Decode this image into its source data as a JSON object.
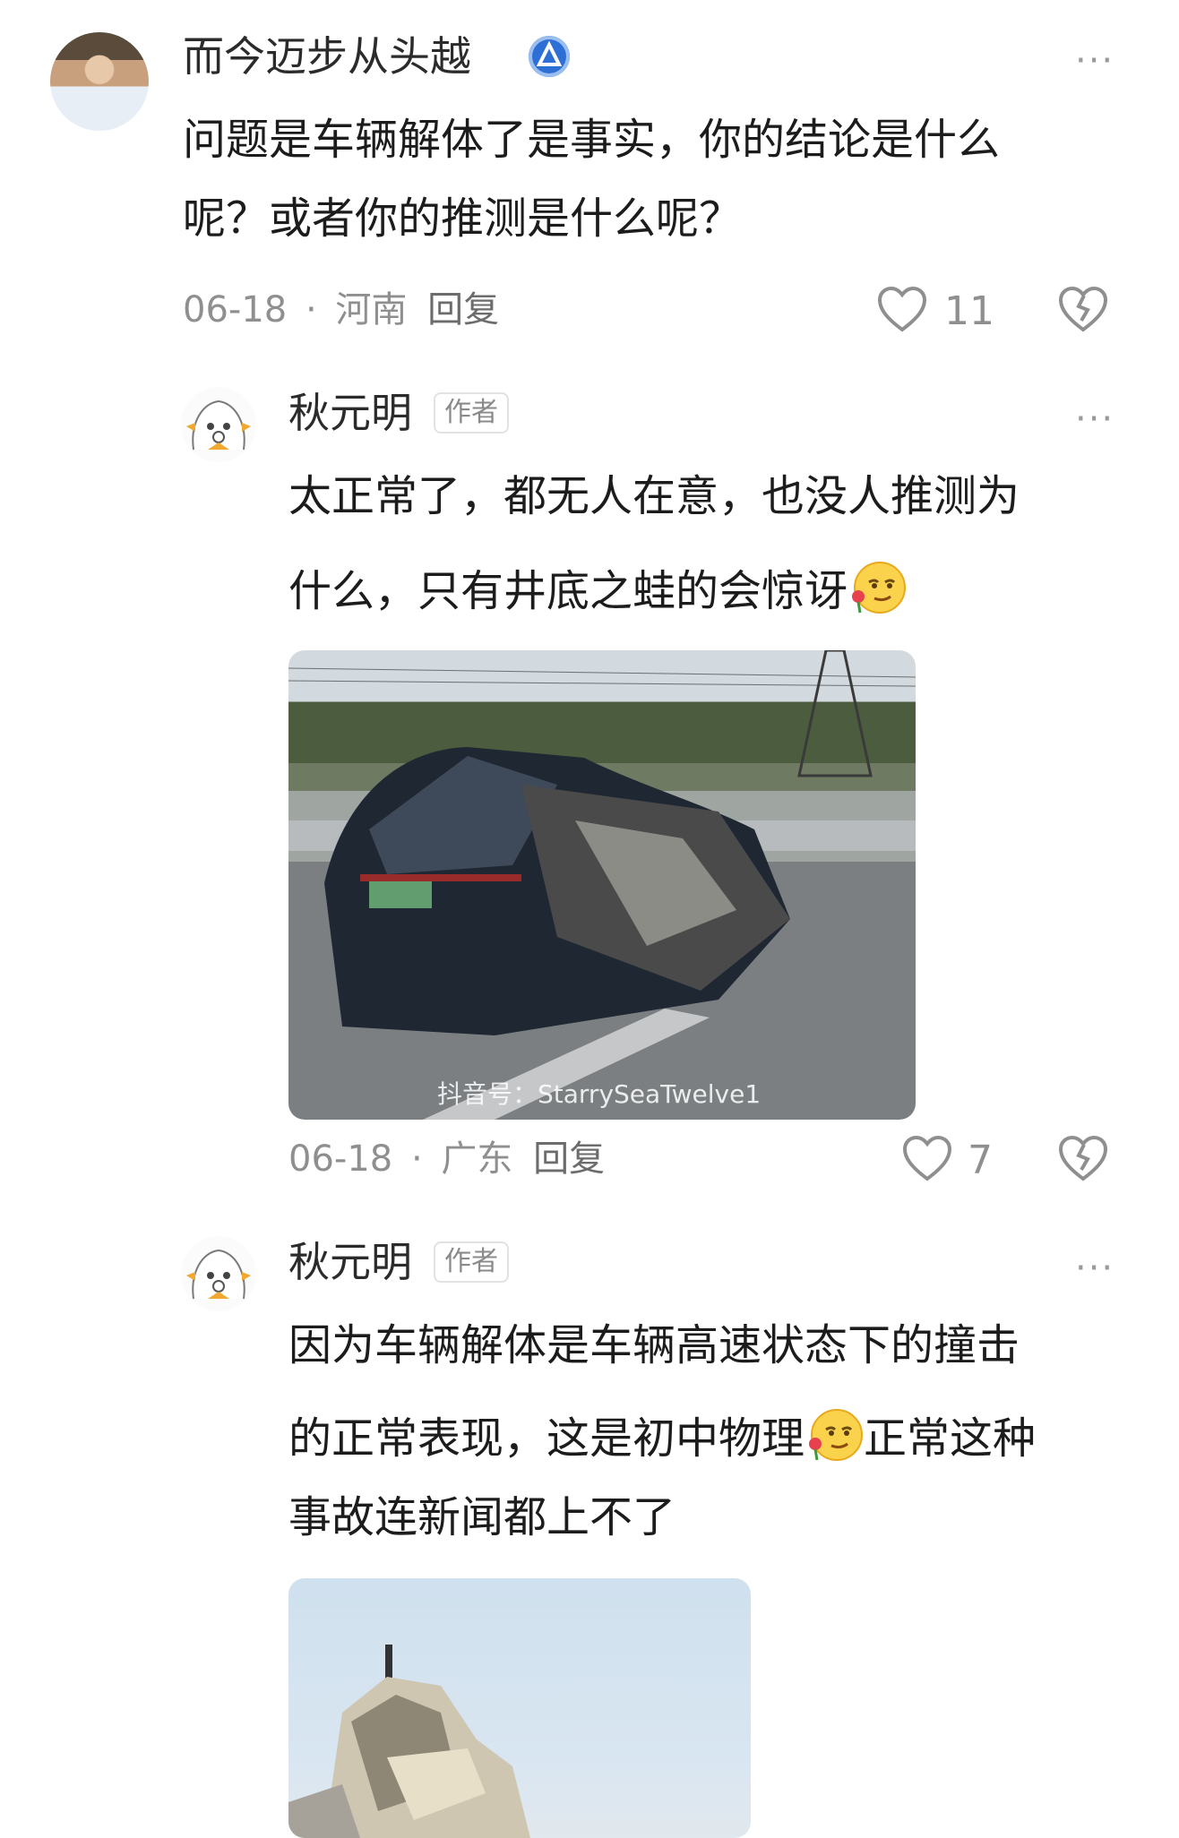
{
  "comment1": {
    "username": "而今迈步从头越",
    "text_line1": "问题是车辆解体了是事实，你的结论是什么",
    "text_line2": "呢？或者你的推测是什么呢？",
    "date": "06-18",
    "location": "河南",
    "reply_label": "回复",
    "like_count": "11",
    "more_label": "···"
  },
  "reply1": {
    "username": "秋元明",
    "author_tag": "作者",
    "text_line1": "太正常了，都无人在意，也没人推测为",
    "text_line2": "什么，只有井底之蛙的会惊讶",
    "image_watermark": "抖音号：StarrySeaTwelve1",
    "date": "06-18",
    "location": "广东",
    "reply_label": "回复",
    "like_count": "7",
    "more_label": "···"
  },
  "reply2": {
    "username": "秋元明",
    "author_tag": "作者",
    "text_line1": "因为车辆解体是车辆高速状态下的撞击",
    "text_line2a": "的正常表现，这是初中物理",
    "text_line2b": "正常这种",
    "text_line3": "事故连新闻都上不了",
    "more_label": "···"
  },
  "meta_separator": "·",
  "icons": {
    "heart": "heart-outline-icon",
    "dislike": "broken-heart-icon",
    "emoji": "flower-smirk-emoji",
    "verified": "verified-badge-icon"
  }
}
